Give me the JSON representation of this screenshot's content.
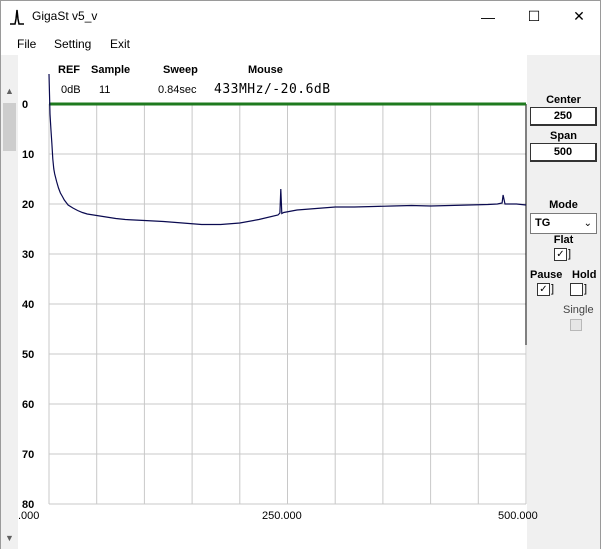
{
  "window": {
    "title": "GigaSt v5_v",
    "minimize_glyph": "—",
    "maximize_glyph": "☐",
    "close_glyph": "✕",
    "icon": "spike-icon"
  },
  "menu": [
    {
      "label": "File"
    },
    {
      "label": "Setting"
    },
    {
      "label": "Exit"
    }
  ],
  "header": {
    "ref_label": "REF",
    "ref_value": "0dB",
    "sample_label": "Sample",
    "sample_value": "11",
    "sweep_label": "Sweep",
    "sweep_value": "0.84sec",
    "mouse_label": "Mouse",
    "mouse_value": "433MHz/-20.6dB"
  },
  "controls": {
    "center_label": "Center",
    "center_value": "250",
    "span_label": "Span",
    "span_value": "500",
    "mode_label": "Mode",
    "mode_value": "TG",
    "flat_label": "Flat",
    "flat_checked": true,
    "pause_label": "Pause",
    "pause_checked": true,
    "hold_label": "Hold",
    "hold_checked": false,
    "single_label": "Single",
    "single_enabled": false
  },
  "scrollbar": {
    "up_glyph": "▲",
    "down_glyph": "▼"
  },
  "colors": {
    "trace": "#0a0a50",
    "reference_line": "#1e7a1e",
    "grid": "#c8c8c8"
  },
  "chart_data": {
    "type": "line",
    "y_tick_labels": [
      "0",
      "10",
      "20",
      "30",
      "40",
      "50",
      "60",
      "70",
      "80"
    ],
    "x_tick_labels": [
      ".000",
      "250.000",
      "500.000"
    ],
    "xlim": [
      0,
      500
    ],
    "ylim": [
      0,
      80
    ],
    "y_inverted": true,
    "grid": true,
    "reference_level": 0,
    "series": [
      {
        "x": [
          0,
          1,
          2,
          3,
          4,
          5,
          6,
          8,
          10,
          12,
          14,
          16,
          18,
          20,
          25,
          30,
          35,
          40,
          50,
          60,
          70,
          80,
          100,
          120,
          140,
          160,
          180,
          200,
          220,
          240,
          242,
          243,
          244,
          246,
          260,
          280,
          300,
          320,
          340,
          360,
          380,
          400,
          420,
          440,
          460,
          470,
          475,
          476,
          478,
          490,
          500
        ],
        "y": [
          -6,
          2,
          5,
          8,
          11,
          13,
          14,
          15.5,
          16.8,
          17.8,
          18.5,
          19.2,
          19.7,
          20.2,
          20.8,
          21.3,
          21.7,
          22,
          22.3,
          22.6,
          22.9,
          23.1,
          23.3,
          23.5,
          23.8,
          24.1,
          24.1,
          23.8,
          23.1,
          22.2,
          21.8,
          17,
          21.9,
          21.7,
          21.2,
          20.9,
          20.6,
          20.6,
          20.5,
          20.4,
          20.3,
          20.4,
          20.3,
          20.2,
          20.1,
          20,
          19.8,
          18.2,
          20,
          20,
          20.2
        ]
      }
    ]
  }
}
